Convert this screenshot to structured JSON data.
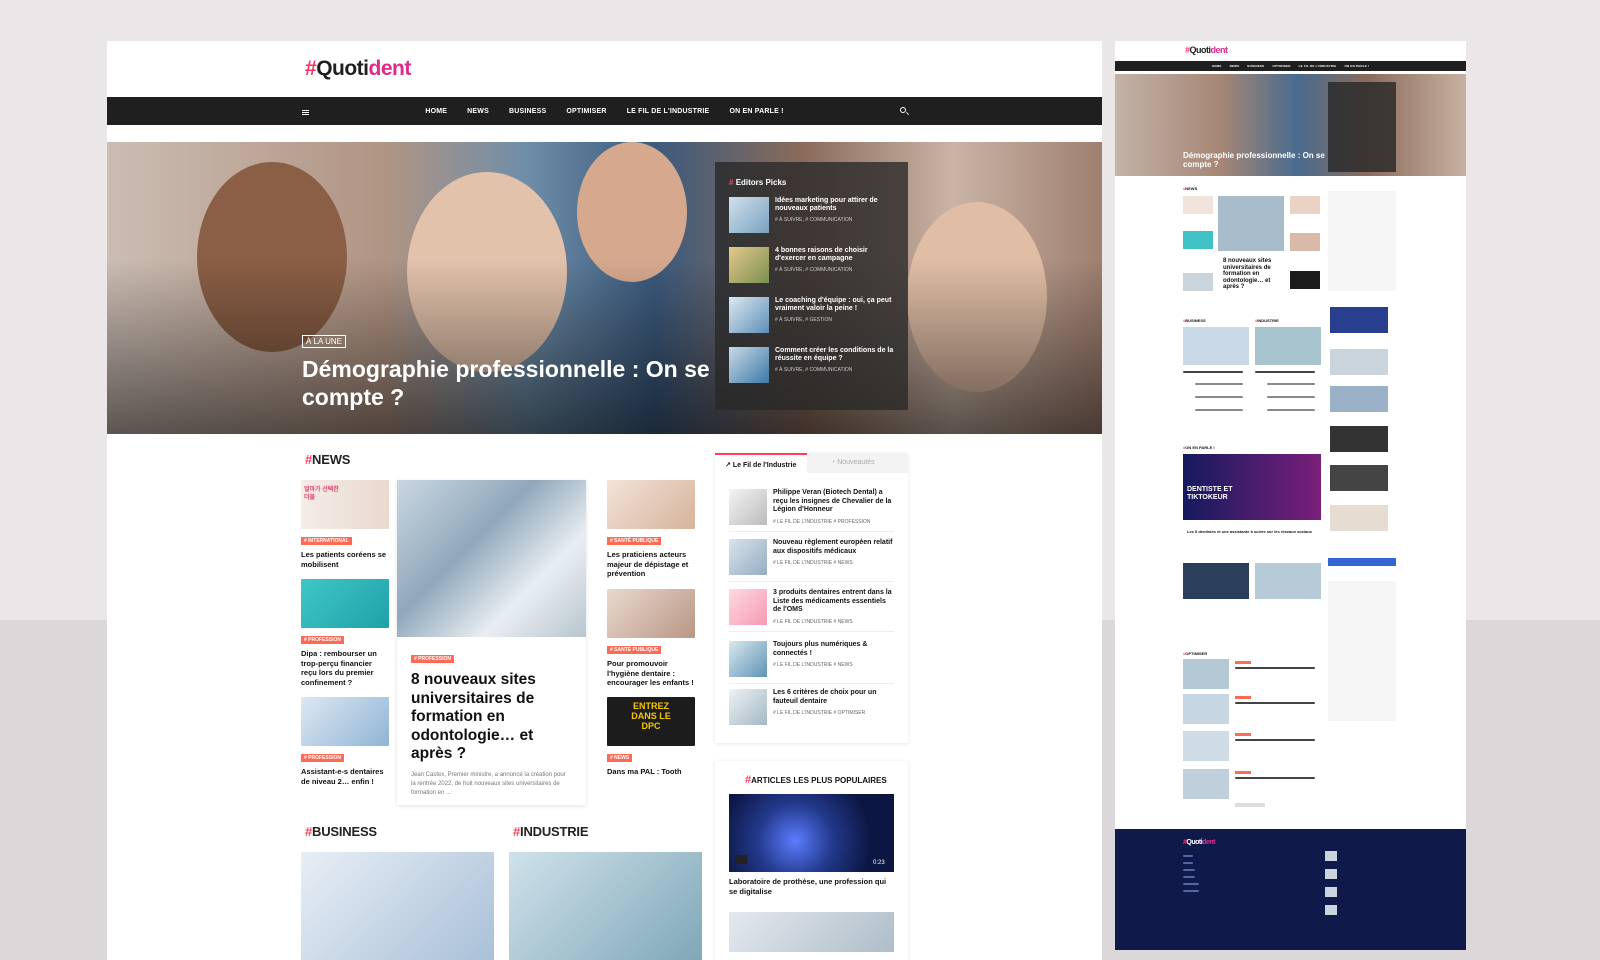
{
  "brand": {
    "hash": "#",
    "name_part1": "Quoti",
    "name_part2": "dent"
  },
  "nav": {
    "items": [
      "HOME",
      "NEWS",
      "BUSINESS",
      "OPTIMISER",
      "LE FIL DE L'INDUSTRIE",
      "ON EN PARLE !"
    ]
  },
  "hero": {
    "badge": "À LA UNE",
    "title": "Démographie professionnelle : On se compte ?"
  },
  "editors_picks": {
    "title": "Editors Picks",
    "items": [
      {
        "title": "Idées marketing pour attirer de nouveaux patients",
        "tags": "# À SUIVRE, # COMMUNICATION"
      },
      {
        "title": "4 bonnes raisons de choisir d'exercer en campagne",
        "tags": "# À SUIVRE, # COMMUNICATION"
      },
      {
        "title": "Le coaching d'équipe : oui, ça peut vraiment valoir la peine !",
        "tags": "# À SUIVRE, # GESTION"
      },
      {
        "title": "Comment créer les conditions de la réussite en équipe ?",
        "tags": "# À SUIVRE, # COMMUNICATION"
      }
    ]
  },
  "news": {
    "title": "NEWS",
    "left": [
      {
        "tag": "# INTERNATIONAL",
        "title": "Les patients coréens se mobilisent",
        "img_text": "얼마가 선택한 더블"
      },
      {
        "tag": "# PROFESSION",
        "title": "Dipa : rembourser un trop-perçu financier reçu lors du premier confinement ?"
      },
      {
        "tag": "# PROFESSION",
        "title": "Assistant-e-s dentaires de niveau 2… enfin !"
      }
    ],
    "featured": {
      "tag": "# PROFESSION",
      "title": "8 nouveaux sites universitaires de formation en odontologie… et après ?",
      "excerpt": "Jean Castex, Premier ministre, a annoncé la création pour la rentrée 2022, de huit nouveaux sites universitaires de formation en ..."
    },
    "right": [
      {
        "tag": "# SANTÉ PUBLIQUE",
        "title": "Les praticiens acteurs majeur de dépistage et prévention"
      },
      {
        "tag": "# SANTÉ PUBLIQUE",
        "title": "Pour promouvoir l'hygiène dentaire : encourager les enfants !"
      },
      {
        "tag": "# NEWS",
        "title": "Dans ma PAL : Tooth",
        "img_text": "ENTREZ DANS LE DPC"
      }
    ]
  },
  "tabs": {
    "active": "Le Fil de l'Industrie",
    "inactive": "Nouveautés",
    "items": [
      {
        "title": "Philippe Veran (Biotech Dental) a reçu les insignes de Chevalier de la Légion d'Honneur",
        "tags": "# LE FIL DE L'INDUSTRIE  # PROFESSION"
      },
      {
        "title": "Nouveau règlement européen relatif aux dispositifs médicaux",
        "tags": "# LE FIL DE L'INDUSTRIE  # NEWS"
      },
      {
        "title": "3 produits dentaires entrent dans la Liste des médicaments essentiels de l'OMS",
        "tags": "# LE FIL DE L'INDUSTRIE  # NEWS"
      },
      {
        "title": "Toujours plus numériques & connectés !",
        "tags": "# LE FIL DE L'INDUSTRIE  # NEWS"
      },
      {
        "title": "Les 6 critères de choix pour un fauteuil dentaire",
        "tags": "# LE FIL DE L'INDUSTRIE  # OPTIMISER"
      }
    ]
  },
  "popular": {
    "title": "ARTICLES LES PLUS POPULAIRES",
    "item_title": "Laboratoire de prothèse, une profession qui se digitalise",
    "duration": "0:23"
  },
  "sections": {
    "business": "BUSINESS",
    "industrie": "INDUSTRIE"
  },
  "mini": {
    "hero_title": "Démographie professionnelle : On se compte ?",
    "news": "NEWS",
    "business": "BUSINESS",
    "industrie": "INDUSTRIE",
    "on_en_parle": "ON EN PARLE !",
    "optimiser": "OPTIMISER",
    "featured": "8 nouveaux sites universitaires de formation en odontologie… et après ?",
    "video_title": "DENTISTE ET TIKTOKEUR",
    "video_caption": "Les 5 dentistes et une assistante à suivre sur les réseaux sociaux"
  },
  "colors": {
    "accent": "#ff3d5a",
    "tag": "#ff6a55",
    "nav": "#1f1f1f",
    "footer": "#0f1a4b"
  }
}
